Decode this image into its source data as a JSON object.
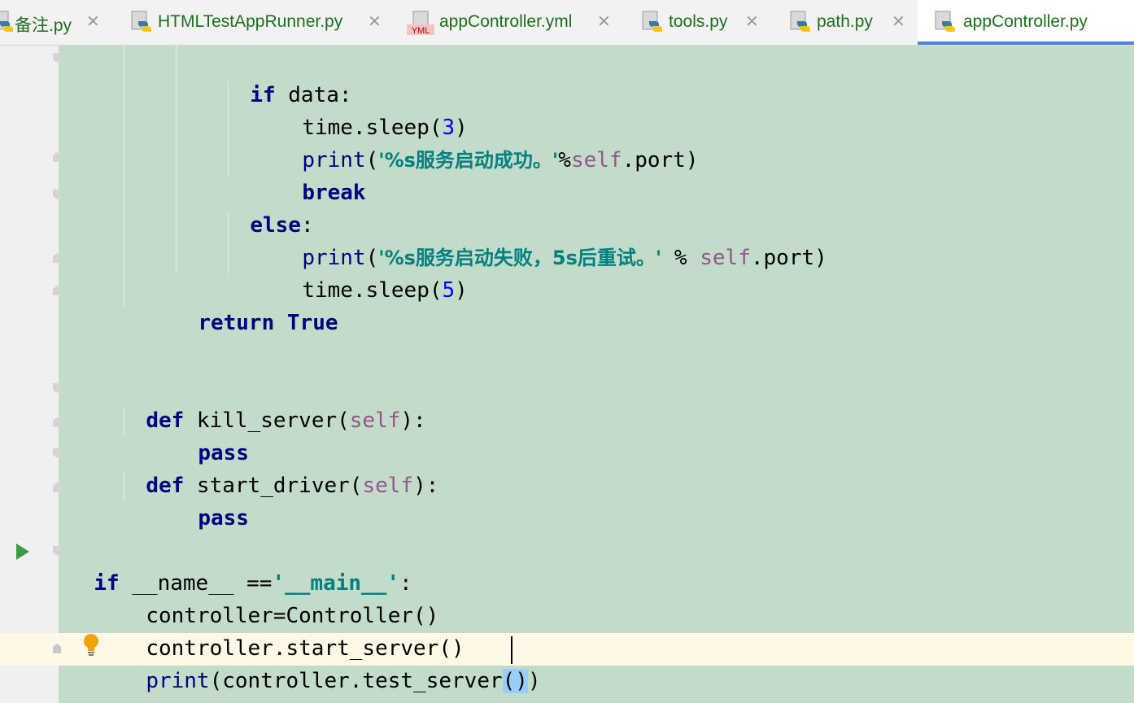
{
  "tabs": [
    {
      "label": "备注.py",
      "icon": "python-file-icon",
      "active": false
    },
    {
      "label": "HTMLTestAppRunner.py",
      "icon": "python-file-icon",
      "active": false
    },
    {
      "label": "appController.yml",
      "icon": "yml-file-icon",
      "active": false
    },
    {
      "label": "tools.py",
      "icon": "python-file-icon",
      "active": false
    },
    {
      "label": "path.py",
      "icon": "python-file-icon",
      "active": false
    },
    {
      "label": "appController.py",
      "icon": "python-file-icon",
      "active": true
    }
  ],
  "yml_badge": "YML",
  "close_glyph": "✕",
  "code": {
    "l1": {
      "kw": "if",
      "rest": " data:"
    },
    "l2": {
      "a": "time.sleep(",
      "num": "3",
      "b": ")"
    },
    "l3": {
      "fn": "print",
      "a": "(",
      "str": "'%s服务启动成功。'",
      "b": "%",
      "self": "self",
      "c": ".port)"
    },
    "l4": {
      "kw": "break"
    },
    "l5": {
      "kw": "else",
      "rest": ":"
    },
    "l6": {
      "fn": "print",
      "a": "(",
      "str": "'%s服务启动失败，5s后重试。'",
      "b": " % ",
      "self": "self",
      "c": ".port)"
    },
    "l7": {
      "a": "time.sleep(",
      "num": "5",
      "b": ")"
    },
    "l8": {
      "kw1": "return",
      "kw2": "True"
    },
    "l9": {
      "kw": "def",
      "a": " kill_server(",
      "self": "self",
      "b": "):"
    },
    "l10": {
      "kw": "pass"
    },
    "l11": {
      "kw": "def",
      "a": " start_driver(",
      "self": "self",
      "b": "):"
    },
    "l12": {
      "kw": "pass"
    },
    "l13": {
      "kw": "if",
      "a": " __name__ ==",
      "str": "'__main__'",
      "b": ":"
    },
    "l14": {
      "a": "controller=Controller()"
    },
    "l15": {
      "a": "controller.start_server()"
    },
    "l16": {
      "fn": "print",
      "a": "(controller.test_server",
      "hl": "()",
      "b": ")"
    }
  },
  "colors": {
    "editor_bg": "#c2dcc9",
    "keyword": "#000080",
    "string": "#008080",
    "number": "#0000ff",
    "self": "#94558d",
    "tab_text": "#1c6f1c",
    "active_tab_underline": "#4a84d1"
  }
}
